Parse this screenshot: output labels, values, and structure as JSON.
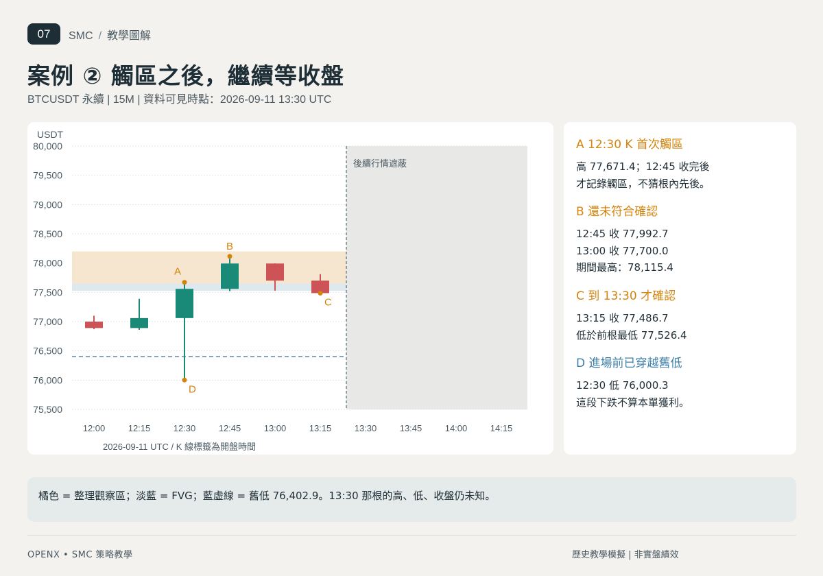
{
  "header": {
    "badge": "07",
    "crumb_main": "SMC",
    "crumb_sep": "/",
    "crumb_sub": "教學圖解",
    "title": "案例 ② 觸區之後，繼續等收盤",
    "subtitle": "BTCUSDT 永續 | 15M | 資料可見時點：2026-09-11 13:30 UTC"
  },
  "chart_data": {
    "type": "candlestick",
    "ylabel": "USDT",
    "ylim": [
      75500,
      80000
    ],
    "y_ticks": [
      80000,
      79500,
      79000,
      78500,
      78000,
      77500,
      77000,
      76500,
      76000,
      75500
    ],
    "y_tick_labels": [
      "80,000",
      "79,500",
      "79,000",
      "78,500",
      "78,000",
      "77,500",
      "77,000",
      "76,500",
      "76,000",
      "75,500"
    ],
    "x_labels": [
      "12:00",
      "12:15",
      "12:30",
      "12:45",
      "13:00",
      "13:15",
      "13:30",
      "13:45",
      "14:00",
      "14:15"
    ],
    "x_footer": "2026-09-11 UTC    /    K 線標籤為開盤時間",
    "candles": [
      {
        "time": "12:00",
        "open": 77000,
        "high": 77100,
        "low": 76870,
        "close": 76890
      },
      {
        "time": "12:15",
        "open": 76890,
        "high": 77390,
        "low": 76860,
        "close": 77060
      },
      {
        "time": "12:30",
        "open": 77060,
        "high": 77671.4,
        "low": 76000.3,
        "close": 77560
      },
      {
        "time": "12:45",
        "open": 77560,
        "high": 78115.4,
        "low": 77520,
        "close": 77992.7
      },
      {
        "time": "13:00",
        "open": 77992.7,
        "high": 77995,
        "low": 77530,
        "close": 77700.0
      },
      {
        "time": "13:15",
        "open": 77700.0,
        "high": 77810,
        "low": 77480,
        "close": 77486.7
      }
    ],
    "zones": {
      "observation": {
        "from": 77650,
        "to": 78200,
        "color": "#f6e6cf"
      },
      "fvg": {
        "from": 77526.4,
        "to": 77650,
        "color": "#dde8ef"
      }
    },
    "old_low": 76402.9,
    "mask_from": "13:30",
    "mask_label": "後續行情遮蔽",
    "markers": [
      {
        "label": "A",
        "time": "12:30",
        "price": 77671.4,
        "pos": "above"
      },
      {
        "label": "B",
        "time": "12:45",
        "price": 78115.4,
        "pos": "above"
      },
      {
        "label": "C",
        "time": "13:15",
        "price": 77486.7,
        "pos": "below-right"
      },
      {
        "label": "D",
        "time": "12:30",
        "price": 76000.3,
        "pos": "below-right"
      }
    ],
    "colors": {
      "up": "#1a8a78",
      "down": "#cd5356",
      "marker": "#d4840d",
      "old_low": "#4b7fa6",
      "mask": "#e8e8e6"
    }
  },
  "side": [
    {
      "head": "A 12:30 K 首次觸區",
      "color": "#d4840d",
      "lines": [
        "高 77,671.4；12:45 收完後",
        "才記錄觸區，不猜根內先後。"
      ]
    },
    {
      "head": "B 還未符合確認",
      "color": "#d4840d",
      "lines": [
        "12:45 收 77,992.7",
        "13:00 收 77,700.0",
        "期間最高：78,115.4"
      ]
    },
    {
      "head": "C 到 13:30 才確認",
      "color": "#d4840d",
      "lines": [
        "13:15 收 77,486.7",
        "低於前根最低 77,526.4"
      ]
    },
    {
      "head": "D 進場前已穿越舊低",
      "color": "#3d7ea8",
      "lines": [
        "12:30 低 76,000.3",
        "這段下跌不算本單獲利。"
      ]
    }
  ],
  "note": "橘色 = 整理觀察區；淡藍 = FVG；藍虛線 = 舊低 76,402.9。13:30 那根的高、低、收盤仍未知。",
  "footer": {
    "left": "OPENX • SMC 策略教學",
    "right": "歷史教學模擬 | 非實盤績效"
  }
}
